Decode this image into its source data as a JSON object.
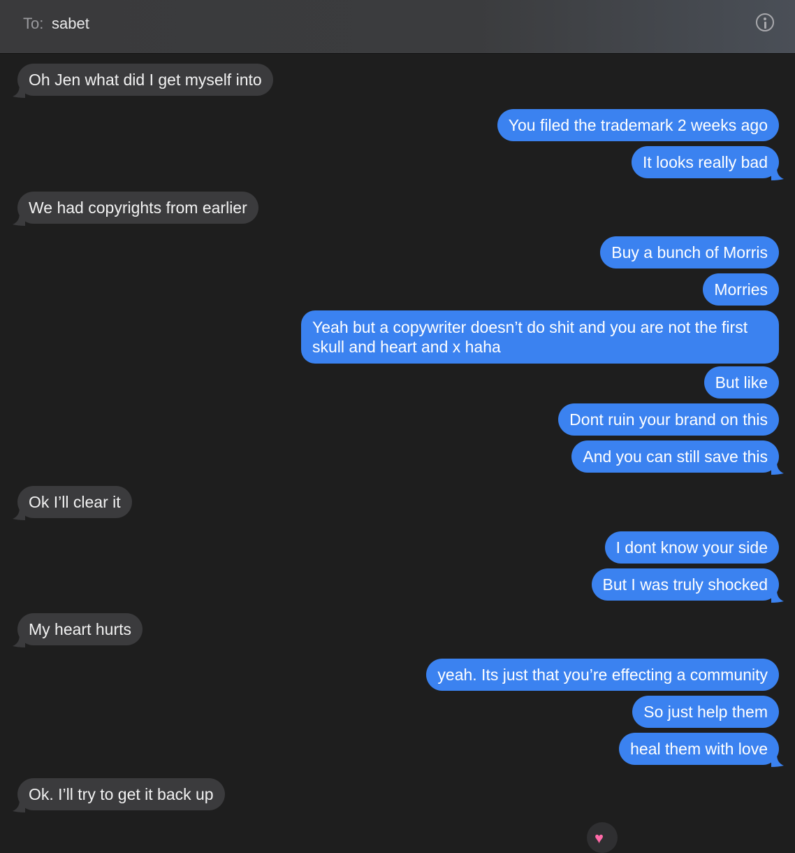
{
  "header": {
    "to_label": "To:",
    "recipient": "sabet",
    "info_icon": "info-icon"
  },
  "colors": {
    "incoming_bubble": "#3b3b3d",
    "outgoing_bubble": "#3b82f0",
    "background": "#1e1e1e"
  },
  "messages": [
    {
      "from": "them",
      "text": "Oh Jen what did I get myself into"
    },
    {
      "from": "me",
      "text": "You filed the trademark 2 weeks ago"
    },
    {
      "from": "me",
      "text": "It looks really bad"
    },
    {
      "from": "them",
      "text": "We had copyrights from earlier"
    },
    {
      "from": "me",
      "text": "Buy a bunch of Morris"
    },
    {
      "from": "me",
      "text": "Morries"
    },
    {
      "from": "me",
      "text": "Yeah but a copywriter doesn’t do shit and you are not the first skull and heart and x haha"
    },
    {
      "from": "me",
      "text": "But like"
    },
    {
      "from": "me",
      "text": "Dont ruin your brand on this"
    },
    {
      "from": "me",
      "text": "And you can still save this"
    },
    {
      "from": "them",
      "text": "Ok I’ll clear it"
    },
    {
      "from": "me",
      "text": "I dont know your side"
    },
    {
      "from": "me",
      "text": "But I was truly shocked"
    },
    {
      "from": "them",
      "text": "My heart hurts"
    },
    {
      "from": "me",
      "text": "yeah. Its just that you’re effecting a community"
    },
    {
      "from": "me",
      "text": "So just help them"
    },
    {
      "from": "me",
      "text": "heal them with love"
    },
    {
      "from": "them",
      "text": "Ok. I’ll try to get it back up"
    }
  ],
  "reaction": {
    "icon": "heart-icon",
    "glyph": "♥"
  }
}
